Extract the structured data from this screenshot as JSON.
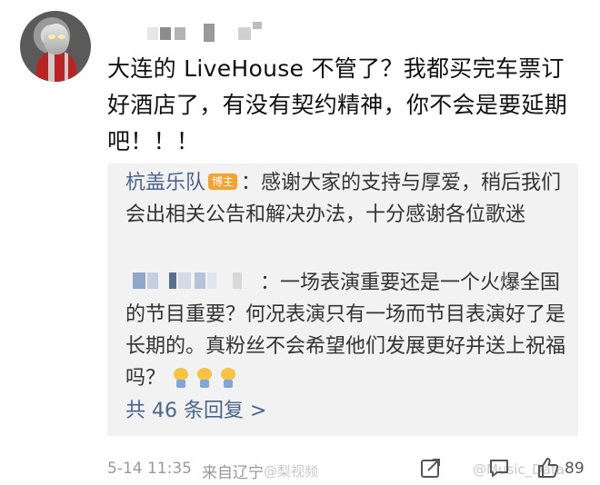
{
  "comment": {
    "username_blurred": "",
    "text": "大连的 LiveHouse 不管了？我都买完车票订好酒店了，有没有契约精神，你不会是要延期吧！！！"
  },
  "replies": [
    {
      "author": "杭盖乐队",
      "badge": "博主",
      "text": "：感谢大家的支持与厚爱，稍后我们会出相关公告和解决办法，十分感谢各位歌迷"
    },
    {
      "author_blurred": "",
      "text": "：一场表演重要还是一个火爆全国的节目重要？何况表演只有一场而节目表演好了是长期的。真粉丝不会希望他们发展更好并送上祝福吗？",
      "emoji_count": 3
    }
  ],
  "more_replies_label": "共 46 条回复 >",
  "footer": {
    "time": "5-14 11:35",
    "location": "来自辽宁",
    "watermark_left": "@梨视频",
    "watermark_right": "@Music_Data",
    "like_count": "89"
  },
  "colors": {
    "link": "#49648f",
    "badge": "#f7a12f",
    "reply_bg": "#f2f2f2"
  },
  "icons": [
    "share-icon",
    "comment-icon",
    "like-icon"
  ]
}
